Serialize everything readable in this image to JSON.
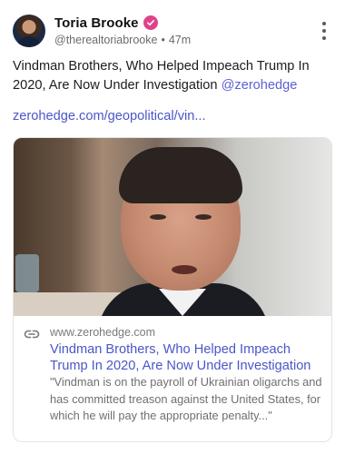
{
  "author": {
    "display_name": "Toria Brooke",
    "handle": "@therealtoriabrooke",
    "separator": "•",
    "timestamp": "47m",
    "verified_badge_color": "#e0428a"
  },
  "post": {
    "text": "Vindman Brothers, Who Helped Impeach Trump In 2020, Are Now Under Investigation",
    "mention": "@zerohedge",
    "link_text": "zerohedge.com/geopolitical/vin...",
    "link_color": "#4a56c8"
  },
  "card": {
    "domain": "www.zerohedge.com",
    "title": "Vindman Brothers, Who Helped Impeach Trump In 2020, Are Now Under Investigation",
    "description": "\"Vindman is on the payroll of Ukrainian oligarchs and has committed treason against the United States, for which he will pay the appropriate penalty...\""
  },
  "icons": {
    "more": "more-vertical-icon",
    "link": "link-icon",
    "verified": "verified-check-icon"
  }
}
